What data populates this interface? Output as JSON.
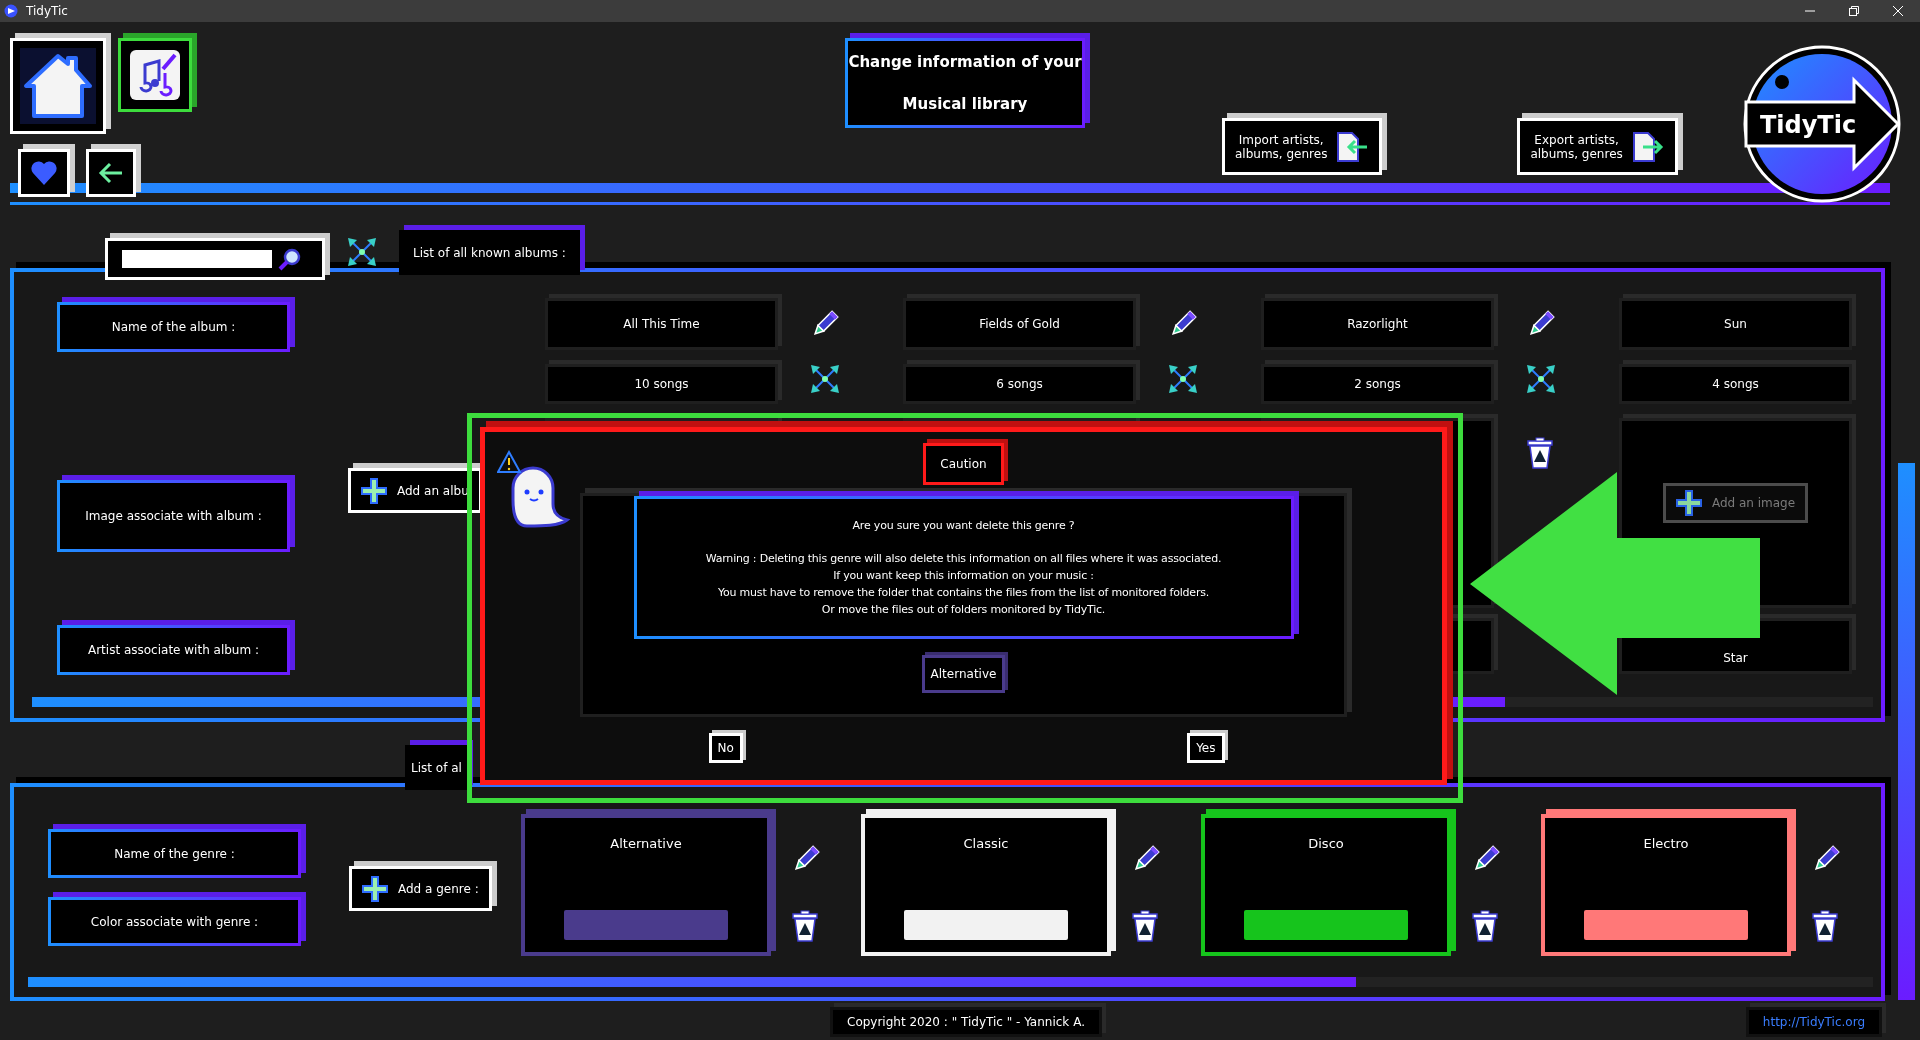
{
  "window": {
    "title": "TidyTic"
  },
  "header": {
    "title_lines": [
      "Change information of your",
      "Musical library"
    ],
    "import_button": [
      "Import artists,",
      "albums, genres"
    ],
    "export_button": [
      "Export artists,",
      "albums, genres"
    ],
    "logo": "TidyTic"
  },
  "albums_section": {
    "tab": "List of all known albums :",
    "labels": [
      "Name of the album :",
      "Image associate with album :",
      "Artist associate with album :"
    ],
    "add_button": "Add an albu",
    "albums": [
      {
        "name": "All This Time",
        "songs": "10 songs"
      },
      {
        "name": "Fields of Gold",
        "songs": "6 songs"
      },
      {
        "name": "Razorlight",
        "songs": "2 songs"
      },
      {
        "name": "Sun",
        "songs": "4 songs",
        "image_button": {
          "label": "Add an image",
          "disabled": true
        },
        "artist": "Star"
      }
    ]
  },
  "genres_section": {
    "tab": "List of al",
    "labels": [
      "Name of the genre :",
      "Color associate with genre :"
    ],
    "add_button": "Add a genre :",
    "genres": [
      {
        "name": "Alternative",
        "color": "#4a3b8c"
      },
      {
        "name": "Classic",
        "color": "#f2f2f2"
      },
      {
        "name": "Disco",
        "color": "#16c41c"
      },
      {
        "name": "Electro",
        "color": "#ff7878"
      }
    ]
  },
  "dialog": {
    "title": "Caution",
    "question": "Are you sure you want delete this genre ?",
    "message_lines": [
      "Warning : Deleting this genre will also delete this information on all files where it was associated.",
      "If you want keep this information on your music :",
      "You must have to remove the folder that contains the files from the list of monitored folders.",
      "Or move the files out of folders monitored by TidyTic."
    ],
    "genre": "Alternative",
    "buttons": [
      "No",
      "Yes"
    ]
  },
  "footer": {
    "copyright": "Copyright 2020 : \" TidyTic \" - Yannick A.",
    "link": "http://TidyTic.org"
  }
}
